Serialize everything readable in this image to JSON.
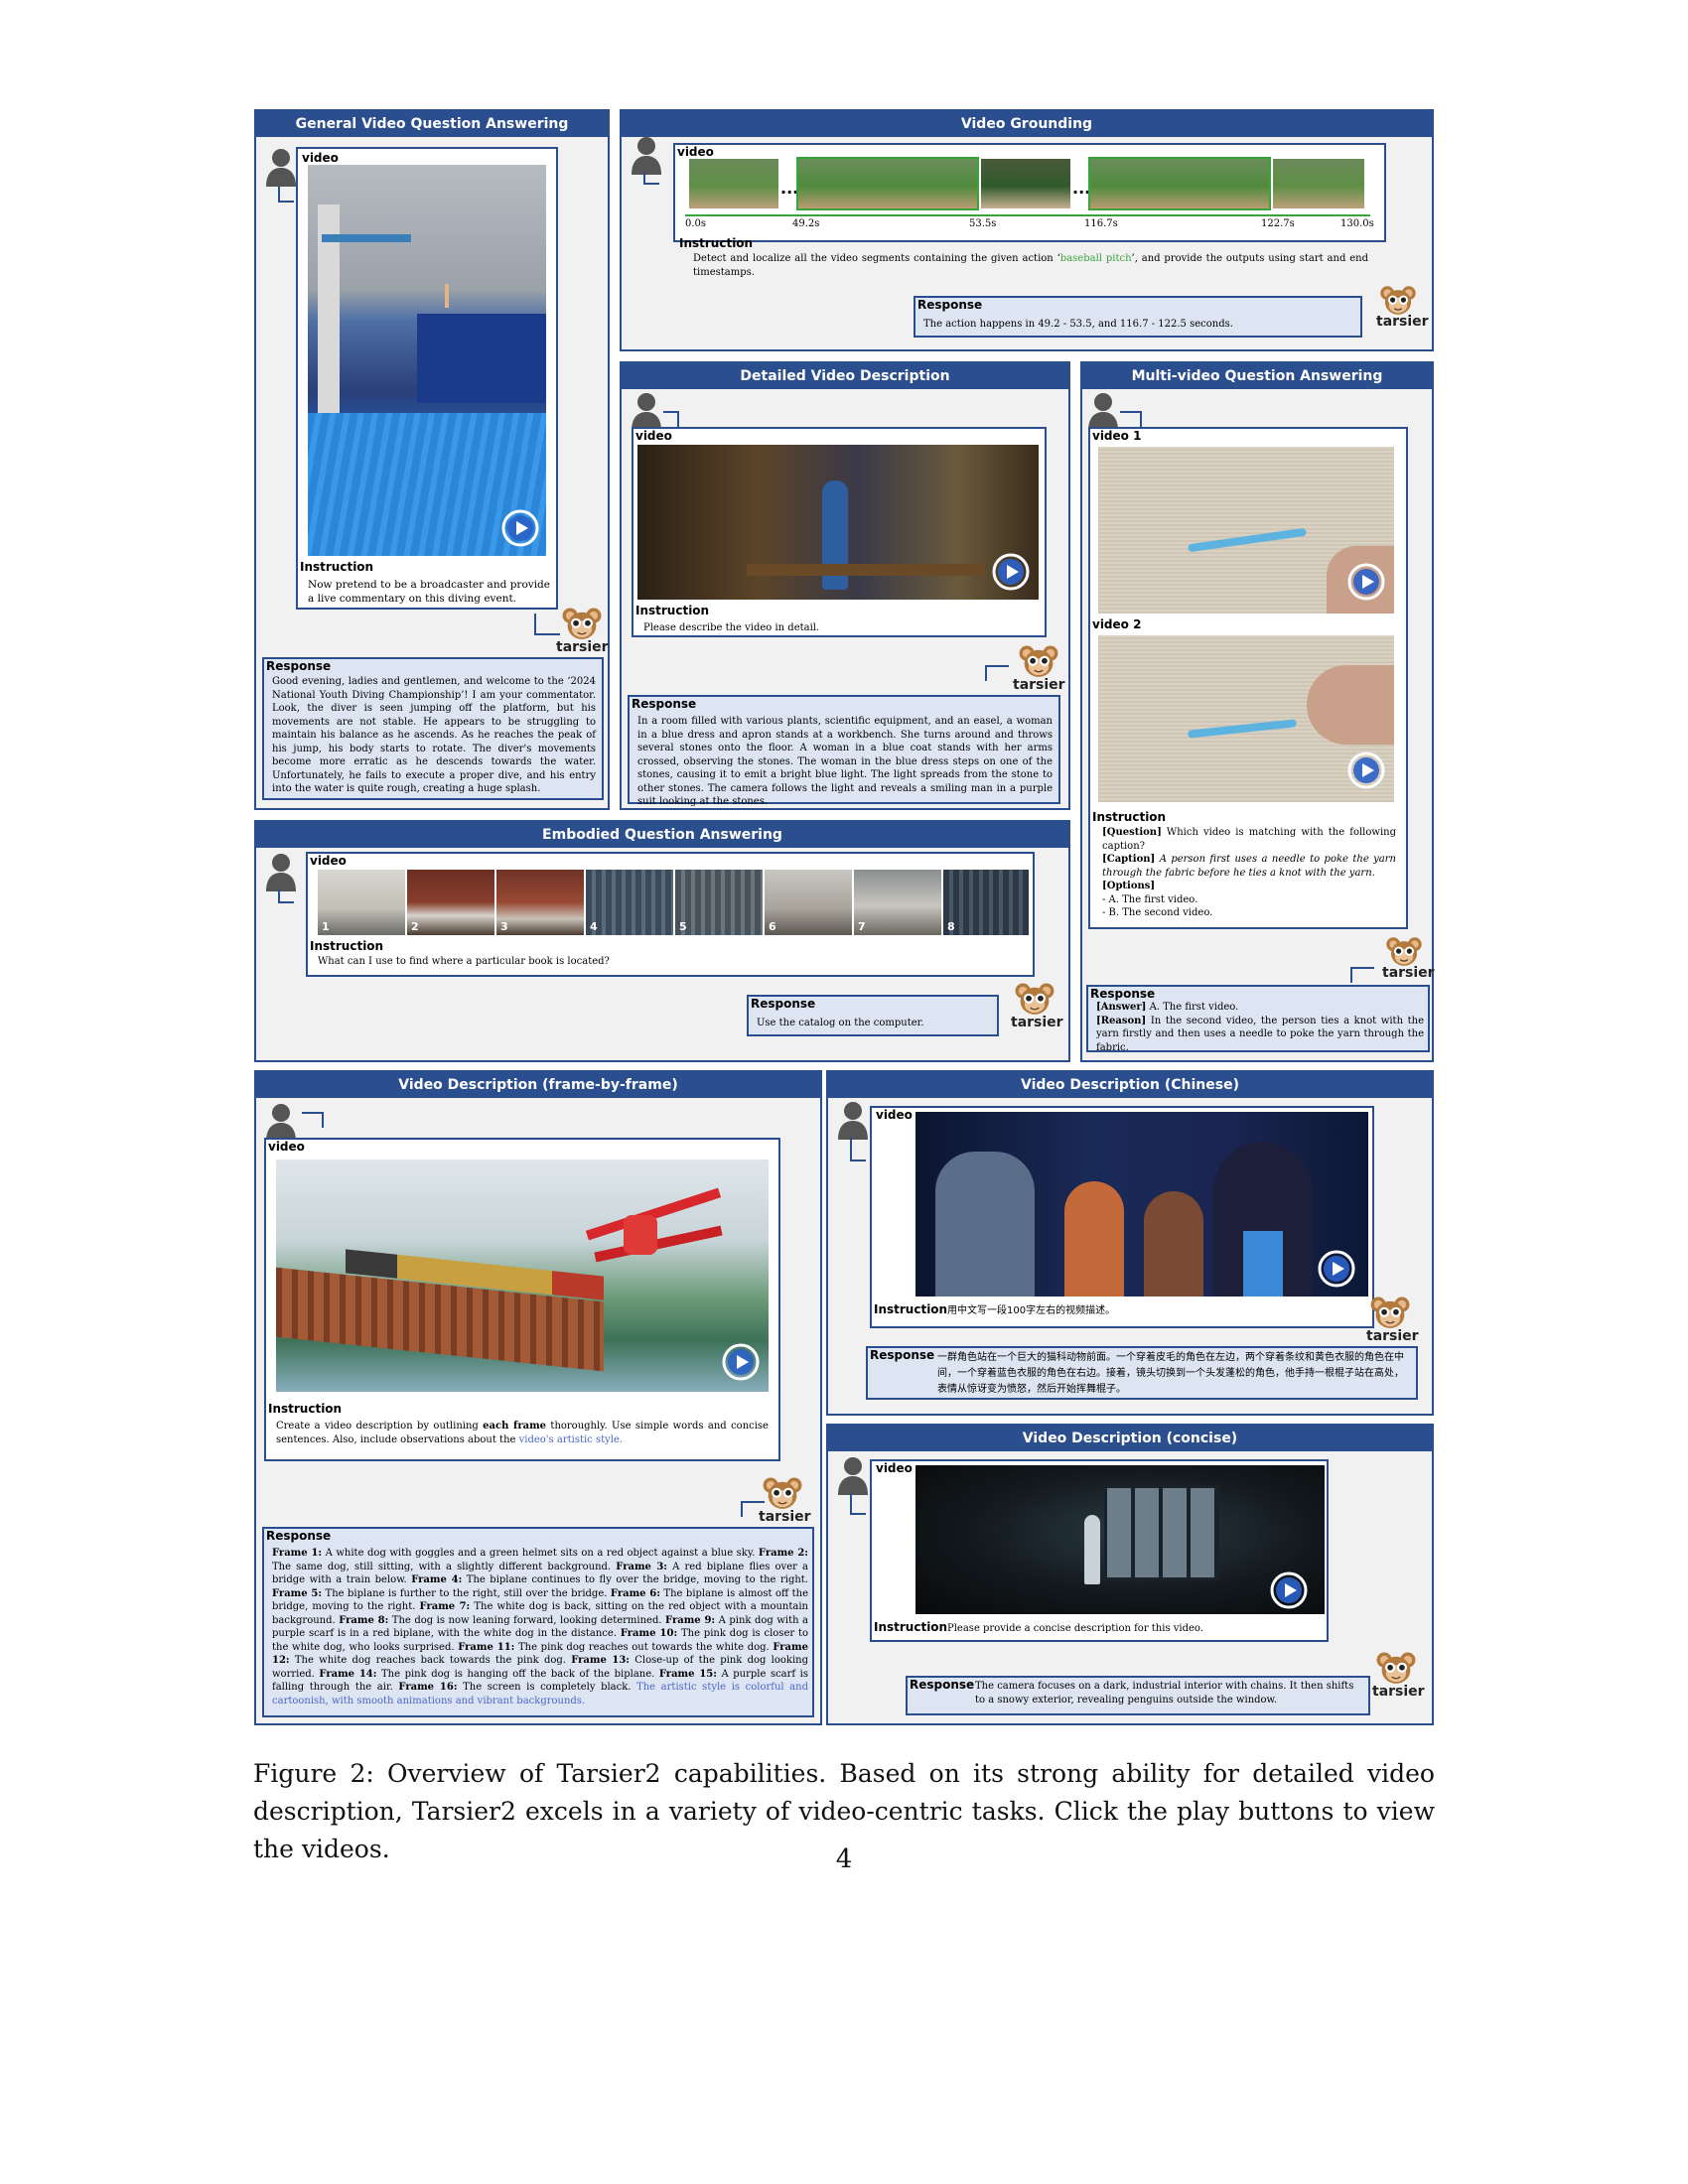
{
  "panels": {
    "gvqa": {
      "title": "General Video Question Answering",
      "video_label": "video",
      "instruction_label": "Instruction",
      "instruction": "Now pretend to be a broadcaster and provide a live commentary on this diving event.",
      "response_label": "Response",
      "response": "Good evening, ladies and gentlemen, and welcome to the ‘2024 National Youth Diving Championship’! I am your commentator. Look, the diver is seen jumping off the platform, but his movements are not stable. He appears to be struggling to maintain his balance as he ascends. As he reaches the peak of his jump, his body starts to rotate. The diver's movements become more erratic as he descends towards the water. Unfortunately, he fails to execute a proper dive, and his entry into the water is quite rough, creating a huge splash."
    },
    "grounding": {
      "title": "Video Grounding",
      "video_label": "video",
      "ticks": [
        "0.0s",
        "49.2s",
        "53.5s",
        "116.7s",
        "122.7s",
        "130.0s"
      ],
      "ellipsis": "...",
      "instruction_label": "Instruction",
      "instruction_pre": "Detect and localize all the video segments containing the given action ‘",
      "instruction_action": "baseball pitch",
      "instruction_post": "’, and provide the outputs using start and end timestamps.",
      "response_label": "Response",
      "response": "The action happens in 49.2 - 53.5, and 116.7 - 122.5 seconds."
    },
    "detailed": {
      "title": "Detailed Video Description",
      "video_label": "video",
      "instruction_label": "Instruction",
      "instruction": "Please describe the video in detail.",
      "response_label": "Response",
      "response": "In a room filled with various plants, scientific equipment, and an easel, a woman in a blue dress and apron stands at a workbench. She turns around and throws several stones onto the floor. A woman in a blue coat stands with her arms crossed, observing the stones. The woman in the blue dress steps on one of the stones, causing it to emit a bright blue light. The light spreads from the stone to other stones. The camera follows the light and reveals a smiling man in a purple suit looking at the stones."
    },
    "multi": {
      "title": "Multi-video Question Answering",
      "video1_label": "video 1",
      "video2_label": "video 2",
      "instruction_label": "Instruction",
      "q_tag": "[Question]",
      "question": "Which video is matching with the following caption?",
      "c_tag": "[Caption]",
      "caption": "A person first uses a needle to poke the yarn through the fabric before he ties a knot with the yarn.",
      "o_tag": "[Options]",
      "option_a": "- A. The first video.",
      "option_b": "- B. The second video.",
      "response_label": "Response",
      "a_tag": "[Answer]",
      "answer": "A. The first video.",
      "r_tag": "[Reason]",
      "reason": "In the second video, the person ties a knot with the yarn firstly and then uses a needle to poke the yarn through the fabric."
    },
    "embodied": {
      "title": "Embodied Question Answering",
      "video_label": "video",
      "frame_numbers": [
        "1",
        "2",
        "3",
        "4",
        "5",
        "6",
        "7",
        "8"
      ],
      "instruction_label": "Instruction",
      "instruction": "What can I use to find where a particular book is located?",
      "response_label": "Response",
      "response": "Use the catalog on the computer."
    },
    "frame": {
      "title": "Video Description (frame-by-frame)",
      "video_label": "video",
      "instruction_label": "Instruction",
      "instr_a": "Create a video description by outlining ",
      "instr_b": "each frame",
      "instr_c": " thoroughly. Use simple words and concise sentences. Also, include observations about the ",
      "instr_d": "video's artistic style.",
      "response_label": "Response",
      "frames": [
        [
          "Frame 1:",
          " A white dog with goggles and a green helmet sits on a red object against a blue sky. "
        ],
        [
          "Frame 2:",
          " The same dog, still sitting, with a slightly different background. "
        ],
        [
          "Frame 3:",
          " A red biplane flies over a bridge with a train below. "
        ],
        [
          "Frame 4:",
          " The biplane continues to fly over the bridge, moving to the right. "
        ],
        [
          "Frame 5:",
          " The biplane is further to the right, still over the bridge. "
        ],
        [
          "Frame 6:",
          " The biplane is almost off the bridge, moving to the right. "
        ],
        [
          "Frame 7:",
          " The white dog is back, sitting on the red object with a mountain background. "
        ],
        [
          "Frame 8:",
          " The dog is now leaning forward, looking determined. "
        ],
        [
          "Frame 9:",
          " A pink dog with a purple scarf is in a red biplane, with the white dog in the distance. "
        ],
        [
          "Frame 10:",
          " The pink dog is closer to the white dog, who looks surprised. "
        ],
        [
          "Frame 11:",
          " The pink dog reaches out towards the white dog. "
        ],
        [
          "Frame 12:",
          " The white dog reaches back towards the pink dog. "
        ],
        [
          "Frame 13:",
          " Close-up of the pink dog looking worried. "
        ],
        [
          "Frame 14:",
          " The pink dog is hanging off the back of the biplane. "
        ],
        [
          "Frame 15:",
          " A purple scarf is falling through the air. "
        ],
        [
          "Frame 16:",
          " The screen is completely black. "
        ]
      ],
      "style_note": "The artistic style is colorful and cartoonish, with smooth animations and vibrant backgrounds."
    },
    "chinese": {
      "title": "Video Description (Chinese)",
      "video_label": "video",
      "instruction_label": "Instruction",
      "instruction": "用中文写一段100字左右的视频描述。",
      "response_label": "Response",
      "response": "一群角色站在一个巨大的猫科动物前面。一个穿着皮毛的角色在左边，两个穿着条纹和黄色衣服的角色在中间，一个穿着蓝色衣服的角色在右边。接着，镜头切换到一个头发蓬松的角色，他手持一根棍子站在高处，表情从惊讶变为愤怒，然后开始挥舞棍子。"
    },
    "concise": {
      "title": "Video Description (concise)",
      "video_label": "video",
      "instruction_label": "Instruction",
      "instruction": "Please provide a concise description for this video.",
      "response_label": "Response",
      "response": "The camera focuses on a dark, industrial interior with chains. It then shifts to a snowy exterior, revealing penguins outside the window."
    }
  },
  "mascot_name": "tarsier",
  "caption": "Figure 2: Overview of Tarsier2 capabilities. Based on its strong ability for detailed video description, Tarsier2 excels in a variety of video-centric tasks. Click the play buttons to view the videos.",
  "page_number": "4",
  "colors": {
    "accent": "#2b4f8e",
    "response_bg": "#dde4f2",
    "panel_bg": "#f1f1f1",
    "action_green": "#3aa33a",
    "style_blue": "#4a67c8"
  }
}
